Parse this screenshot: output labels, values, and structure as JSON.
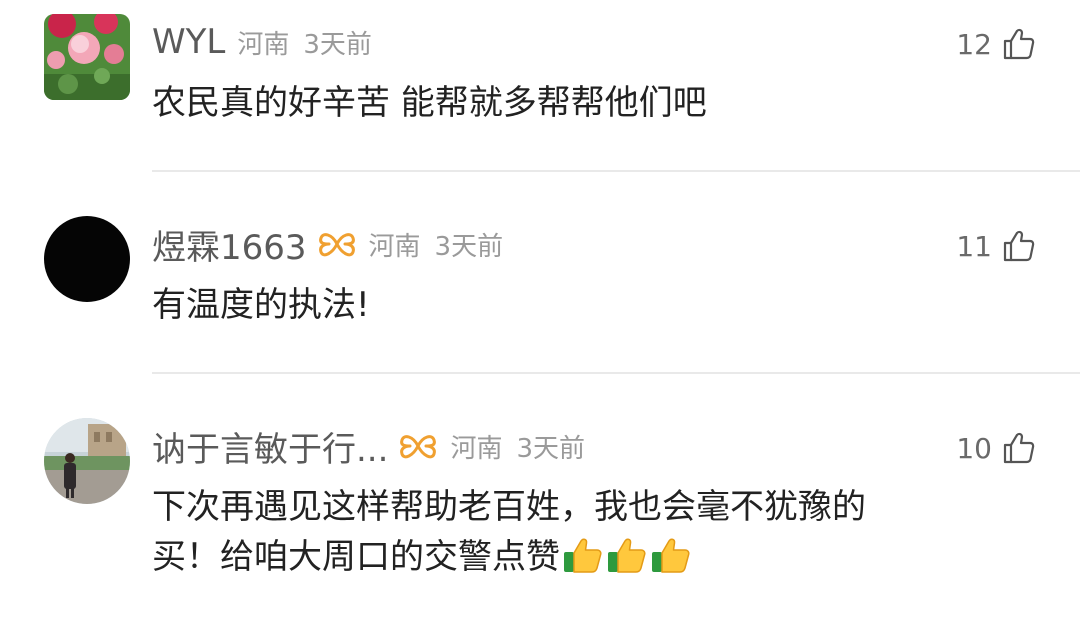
{
  "comments": [
    {
      "username": "WYL",
      "region": "河南",
      "time": "3天前",
      "likes": "12",
      "text": "农民真的好辛苦 能帮就多帮帮他们吧",
      "avatar": "flower-photo"
    },
    {
      "username": "煜霖1663",
      "region": "河南",
      "time": "3天前",
      "likes": "11",
      "text": "有温度的执法!",
      "avatar": "black-circle",
      "vip_badge": "butterfly-icon"
    },
    {
      "username": "讷于言敏于行...",
      "region": "河南",
      "time": "3天前",
      "likes": "10",
      "text_line1": "下次再遇见这样帮助老百姓，我也会毫不犹豫的",
      "text_line2": "买！给咱大周口的交警点赞",
      "avatar": "person-photo",
      "vip_badge": "butterfly-icon",
      "emoji": [
        "thumbs-up-emoji",
        "thumbs-up-emoji",
        "thumbs-up-emoji"
      ]
    }
  ],
  "colors": {
    "username": "#5a5a5a",
    "meta": "#9a9a9a",
    "vip_badge": "#f0a030",
    "divider": "#e9e9e9"
  }
}
